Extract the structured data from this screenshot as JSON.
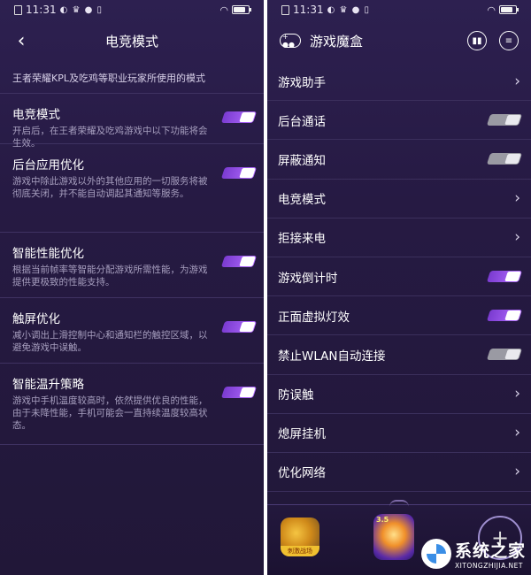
{
  "status": {
    "time": "11:31"
  },
  "esports": {
    "title": "电竞模式",
    "intro": "王者荣耀KPL及吃鸡等职业玩家所使用的模式",
    "settings": [
      {
        "title": "电竞模式",
        "desc": "开启后，在王者荣耀及吃鸡游戏中以下功能将会生效。",
        "on": true
      },
      {
        "title": "后台应用优化",
        "desc": "游戏中除此游戏以外的其他应用的一切服务将被彻底关闭，并不能自动调起其通知等服务。",
        "on": true
      },
      {
        "title": "智能性能优化",
        "desc": "根据当前帧率等智能分配游戏所需性能，为游戏提供更极致的性能支持。",
        "on": true
      },
      {
        "title": "触屏优化",
        "desc": "减小调出上滑控制中心和通知栏的触控区域，以避免游戏中误触。",
        "on": true
      },
      {
        "title": "智能温升策略",
        "desc": "游戏中手机温度较高时，依然提供优良的性能，由于未降性能，手机可能会一直持续温度较高状态。",
        "on": true
      }
    ]
  },
  "gamebox": {
    "title": "游戏魔盒",
    "items": [
      {
        "label": "游戏助手",
        "control": "chevron"
      },
      {
        "label": "后台通话",
        "control": "toggle",
        "on": false
      },
      {
        "label": "屏蔽通知",
        "control": "toggle",
        "on": false
      },
      {
        "label": "电竞模式",
        "control": "chevron"
      },
      {
        "label": "拒接来电",
        "control": "chevron"
      },
      {
        "label": "游戏倒计时",
        "control": "toggle",
        "on": true
      },
      {
        "label": "正面虚拟灯效",
        "control": "toggle",
        "on": true
      },
      {
        "label": "禁止WLAN自动连接",
        "control": "toggle",
        "on": false
      },
      {
        "label": "防误触",
        "control": "chevron"
      },
      {
        "label": "熄屏挂机",
        "control": "chevron"
      },
      {
        "label": "优化网络",
        "control": "chevron"
      }
    ],
    "tray": {
      "apps": [
        {
          "name": "game-app-pubg",
          "ribbon": "刺激战场"
        },
        {
          "name": "game-app-honor-of-kings",
          "badge": "3.5"
        }
      ]
    }
  },
  "watermark": {
    "main": "系统之家",
    "sub": "XITONGZHIJIA.NET"
  },
  "colors": {
    "toggle_on": "#a55cf2",
    "toggle_off": "#9a9aa3",
    "background": "#261a43"
  }
}
